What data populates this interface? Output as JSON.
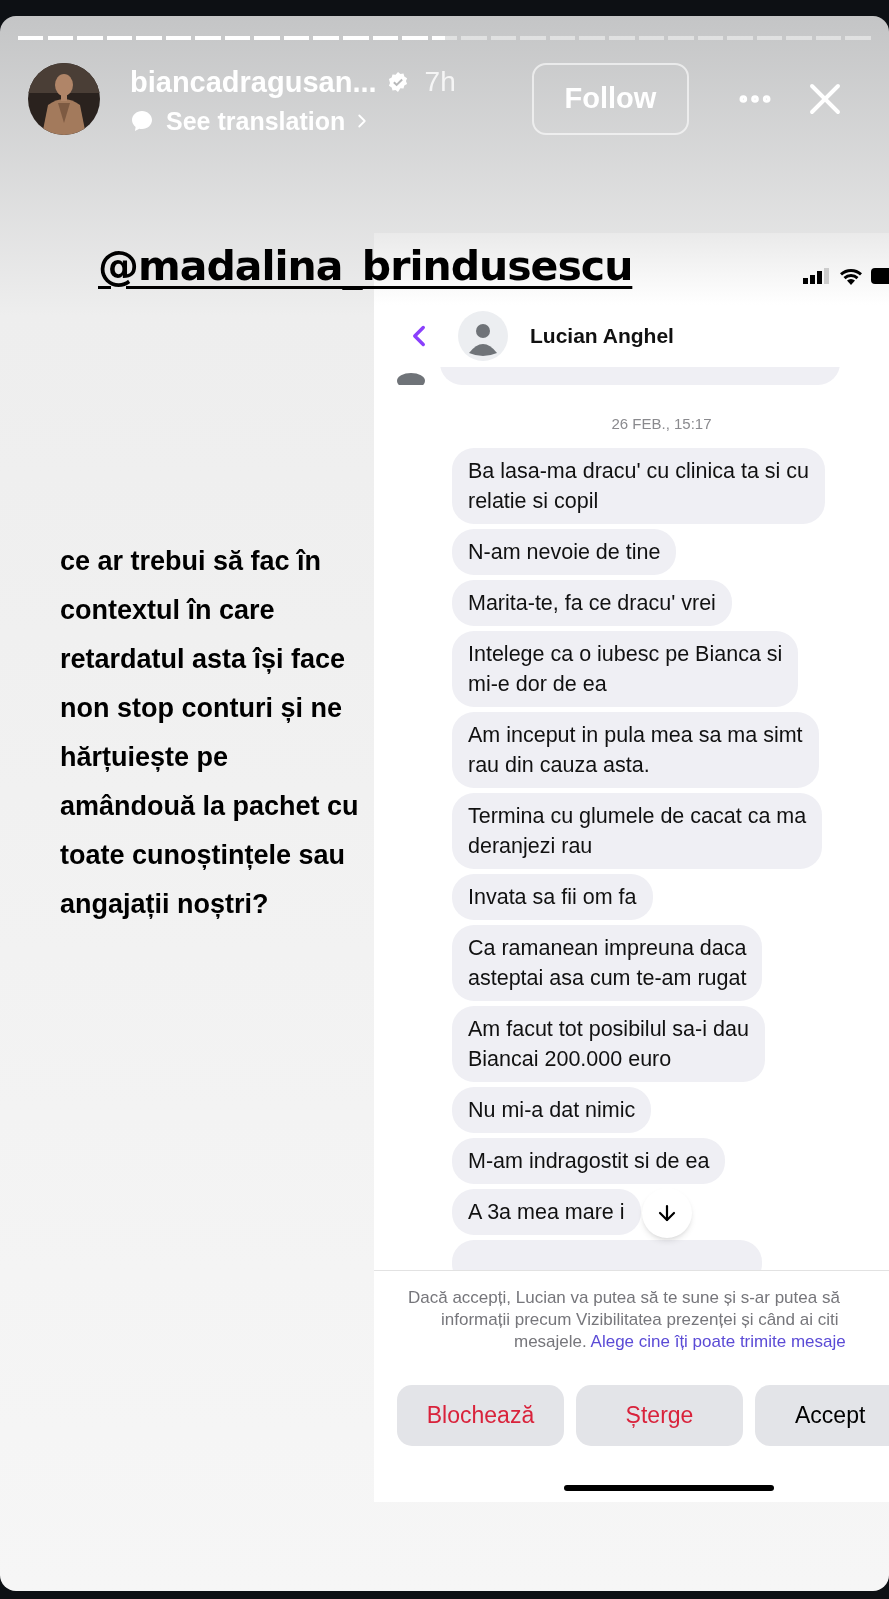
{
  "story": {
    "progress": {
      "level": 0.5
    },
    "username": "biancadragusan...",
    "verified": true,
    "age": "7h",
    "translation_link": "See translation",
    "follow_button": "Follow"
  },
  "mention": "@madalina_brindusescu",
  "caption_lines": [
    "ce ar trebui să fac în",
    "contextul în care",
    "retardatul asta își face",
    "non stop conturi și ne",
    "hărțuiește pe",
    "amândouă la pachet cu",
    "toate cunoștințele sau",
    "angajații noștri?"
  ],
  "chat": {
    "contact_name": "Lucian Anghel",
    "date": "26 FEB., 15:17",
    "messages": [
      {
        "lines": [
          "Ba lasa-ma dracu' cu clinica ta si cu",
          "relatie si copil"
        ]
      },
      {
        "lines": [
          "N-am nevoie de tine"
        ]
      },
      {
        "lines": [
          "Marita-te, fa ce dracu' vrei"
        ]
      },
      {
        "lines": [
          "Intelege ca o iubesc pe Bianca si",
          "mi-e dor de ea"
        ]
      },
      {
        "lines": [
          "Am inceput in pula mea sa ma simt",
          "rau din cauza asta."
        ]
      },
      {
        "lines": [
          "Termina cu glumele de cacat ca ma",
          "deranjezi rau"
        ]
      },
      {
        "lines": [
          "Invata sa fii om fa"
        ]
      },
      {
        "lines": [
          "Ca ramanean impreuna daca",
          "asteptai asa cum te-am rugat"
        ]
      },
      {
        "lines": [
          "Am facut tot posibilul sa-i dau",
          "Biancai 200.000 euro"
        ]
      },
      {
        "lines": [
          "Nu mi-a dat nimic"
        ]
      },
      {
        "lines": [
          "M-am indragostit si de ea"
        ]
      },
      {
        "lines": [
          "A 3a mea mare i"
        ]
      }
    ],
    "notice_lines": [
      "Dacă accepți, Lucian va putea să te sune și s-ar putea să",
      "informații precum Vizibilitatea prezenței și când ai citi"
    ],
    "notice_last": "mesajele.",
    "notice_link": "Alege cine îți poate trimite mesaje",
    "buttons": [
      {
        "label": "Blochează",
        "kind": "danger"
      },
      {
        "label": "Șterge",
        "kind": "danger"
      },
      {
        "label": "Accept",
        "kind": "normal"
      }
    ]
  }
}
